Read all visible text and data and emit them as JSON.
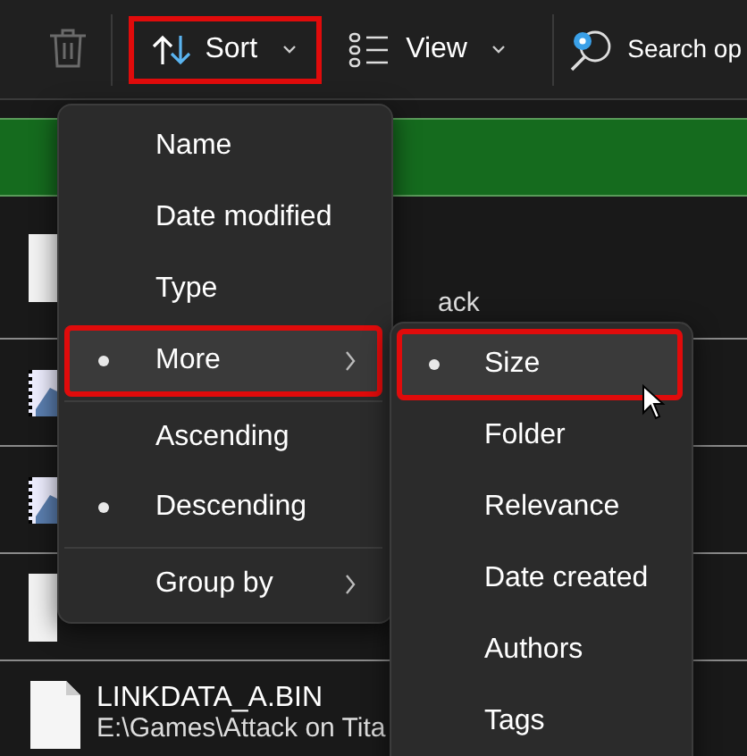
{
  "toolbar": {
    "buttons": [
      {
        "kind": "delete",
        "disabled": true
      },
      {
        "kind": "sort",
        "label": "Sort",
        "dropdown": true,
        "highlighted": true
      },
      {
        "kind": "view",
        "label": "View",
        "dropdown": true,
        "highlighted": false
      },
      {
        "kind": "search",
        "label": "Search op",
        "dropdown": false,
        "highlighted": false
      }
    ]
  },
  "files": [
    {
      "kind": "document",
      "texts": [
        "ack"
      ]
    },
    {
      "kind": "image"
    },
    {
      "kind": "image"
    },
    {
      "kind": "document"
    },
    {
      "kind": "document",
      "texts": [
        "LINKDATA_A.BIN",
        "E:\\Games\\Attack on Tita"
      ]
    }
  ],
  "sort_menu": {
    "items": [
      {
        "label": "Name",
        "selected": false,
        "submenu": false,
        "highlighted": false,
        "divider_before": false
      },
      {
        "label": "Date modified",
        "selected": false,
        "submenu": false,
        "highlighted": false,
        "divider_before": false
      },
      {
        "label": "Type",
        "selected": false,
        "submenu": false,
        "highlighted": false,
        "divider_before": false
      },
      {
        "label": "More",
        "selected": true,
        "submenu": true,
        "highlighted": true,
        "divider_before": false
      },
      {
        "label": "Ascending",
        "selected": false,
        "submenu": false,
        "highlighted": false,
        "divider_before": true
      },
      {
        "label": "Descending",
        "selected": true,
        "submenu": false,
        "highlighted": false,
        "divider_before": false
      },
      {
        "label": "Group by",
        "selected": false,
        "submenu": true,
        "highlighted": false,
        "divider_before": true
      }
    ]
  },
  "more_menu": {
    "items": [
      {
        "label": "Size",
        "selected": true,
        "highlighted": true
      },
      {
        "label": "Folder",
        "selected": false,
        "highlighted": false
      },
      {
        "label": "Relevance",
        "selected": false,
        "highlighted": false
      },
      {
        "label": "Date created",
        "selected": false,
        "highlighted": false
      },
      {
        "label": "Authors",
        "selected": false,
        "highlighted": false
      },
      {
        "label": "Tags",
        "selected": false,
        "highlighted": false
      }
    ]
  }
}
